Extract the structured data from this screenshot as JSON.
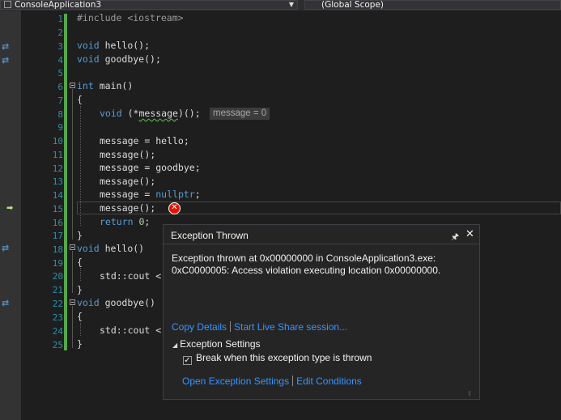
{
  "navbar": {
    "project": "ConsoleApplication3",
    "scope": "(Global Scope)"
  },
  "editor": {
    "line_numbers": [
      "1",
      "2",
      "3",
      "4",
      "5",
      "6",
      "7",
      "8",
      "9",
      "10",
      "11",
      "12",
      "13",
      "14",
      "15",
      "16",
      "17",
      "18",
      "19",
      "20",
      "21",
      "22",
      "23",
      "24",
      "25"
    ],
    "current_line": 15,
    "datatip": "message = 0",
    "colors": {
      "keyword": "#569cd6",
      "number": "#b5cea8",
      "line_number": "#2b91af",
      "change_bar": "#57a64a"
    }
  },
  "code": {
    "l1": {
      "a": "#include ",
      "b": "<iostream>"
    },
    "l3": {
      "kw": "void",
      "rest": " hello();"
    },
    "l4": {
      "kw": "void",
      "rest": " goodbye();"
    },
    "l6": {
      "kw": "int",
      "rest": " main()"
    },
    "l7": "{",
    "l8": {
      "kw": "void",
      "a": " (*",
      "sq": "message",
      "b": ")();"
    },
    "l10": "message = hello;",
    "l11": "message();",
    "l12": "message = goodbye;",
    "l13": "message();",
    "l14": {
      "a": "message = ",
      "kw": "nullptr",
      "b": ";"
    },
    "l15": "message();",
    "l16": {
      "kw": "return",
      "sp": " ",
      "num": "0",
      "b": ";"
    },
    "l17": "}",
    "l18": {
      "kw": "void",
      "rest": " hello()"
    },
    "l19": "{",
    "l20": "std::cout <",
    "l21": "}",
    "l22": {
      "kw": "void",
      "rest": " goodbye()"
    },
    "l23": "{",
    "l24": "std::cout <",
    "l25": "}"
  },
  "exception_popup": {
    "title": "Exception Thrown",
    "message_line1": "Exception thrown at 0x00000000 in ConsoleApplication3.exe:",
    "message_line2": "0xC0000005: Access violation executing location 0x00000000.",
    "copy_details": "Copy Details",
    "live_share": "Start Live Share session...",
    "settings_header": "Exception Settings",
    "break_checkbox": {
      "label": "Break when this exception type is thrown",
      "checked": true
    },
    "open_settings": "Open Exception Settings",
    "edit_conditions": "Edit Conditions"
  },
  "icons": {
    "pin": "pin-icon",
    "close": "close-icon",
    "error": "error-icon",
    "bookmark": "step-into-arrows-icon",
    "current": "current-statement-arrow-icon"
  }
}
